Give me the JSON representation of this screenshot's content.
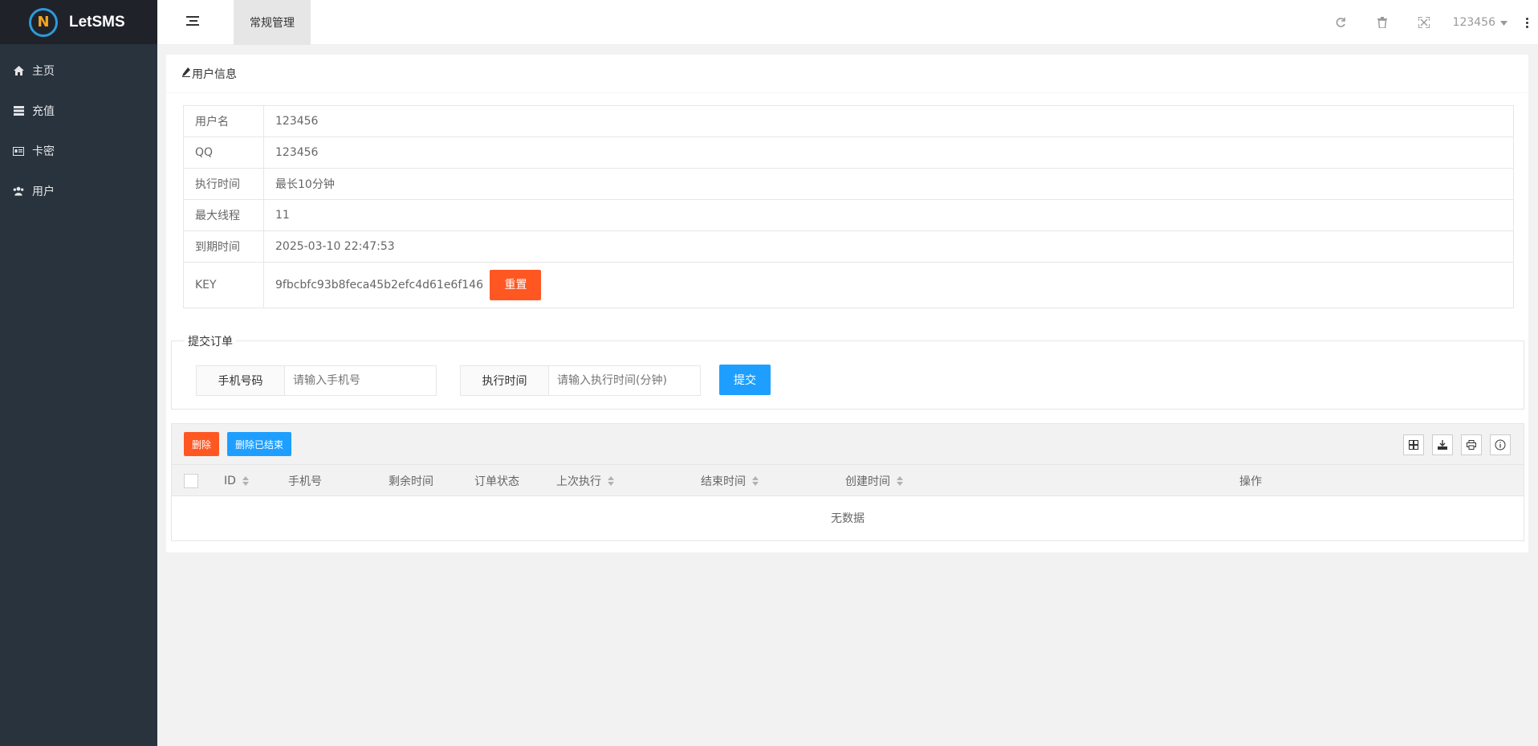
{
  "app": {
    "name": "LetSMS",
    "logo_letter": "N"
  },
  "sidebar": {
    "items": [
      {
        "label": "主页",
        "icon": "home-icon"
      },
      {
        "label": "充值",
        "icon": "server-icon"
      },
      {
        "label": "卡密",
        "icon": "id-card-icon"
      },
      {
        "label": "用户",
        "icon": "users-icon"
      }
    ]
  },
  "header": {
    "active_tab": "常规管理",
    "username": "123456"
  },
  "user_info": {
    "title": "用户信息",
    "rows": [
      {
        "key": "用户名",
        "value": "123456"
      },
      {
        "key": "QQ",
        "value": "123456"
      },
      {
        "key": "执行时间",
        "value": "最长10分钟"
      },
      {
        "key": "最大线程",
        "value": "11"
      },
      {
        "key": "到期时间",
        "value": "2025-03-10 22:47:53"
      }
    ],
    "key_label": "KEY",
    "key_value": "9fbcbfc93b8feca45b2efc4d61e6f146",
    "reset_label": "重置"
  },
  "order_form": {
    "legend": "提交订单",
    "phone_label": "手机号码",
    "phone_placeholder": "请输入手机号",
    "time_label": "执行时间",
    "time_placeholder": "请输入执行时间(分钟)",
    "submit_label": "提交"
  },
  "table": {
    "delete_label": "删除",
    "delete_done_label": "删除已结束",
    "columns": [
      "ID",
      "手机号",
      "剩余时间",
      "订单状态",
      "上次执行",
      "结束时间",
      "创建时间",
      "操作"
    ],
    "empty_text": "无数据"
  },
  "colors": {
    "sidebar_bg": "#28333e",
    "danger": "#ff5722",
    "primary": "#1e9fff"
  }
}
